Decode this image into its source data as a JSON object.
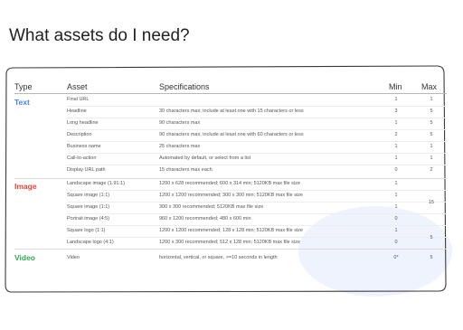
{
  "title": "What assets do I need?",
  "headers": {
    "type": "Type",
    "asset": "Asset",
    "specifications": "Specifications",
    "min": "Min",
    "max": "Max"
  },
  "types": {
    "text": "Text",
    "image": "Image",
    "video": "Video"
  },
  "colors": {
    "text": "#4285f4",
    "image": "#ea4335",
    "video": "#34a853"
  },
  "text_rows": [
    {
      "asset": "Final URL",
      "spec": "",
      "min": "1",
      "max": "1"
    },
    {
      "asset": "Headline",
      "spec": "30 characters max; include at least one with 15 characters or less",
      "min": "3",
      "max": "5"
    },
    {
      "asset": "Long headline",
      "spec": "90 characters max",
      "min": "1",
      "max": "5"
    },
    {
      "asset": "Description",
      "spec": "90 characters max; include at least one with 60 characters or less",
      "min": "2",
      "max": "5"
    },
    {
      "asset": "Business name",
      "spec": "25 characters max",
      "min": "1",
      "max": "1"
    },
    {
      "asset": "Call-to-action",
      "spec": "Automated by default, or select from a list",
      "min": "1",
      "max": "1"
    },
    {
      "asset": "Display URL path",
      "spec": "15 characters max each",
      "min": "0",
      "max": "2"
    }
  ],
  "image_rows": [
    {
      "asset": "Landscape image (1.91:1)",
      "spec": "1200 x 628 recommended; 600 x 314 min; 5120KB max file size",
      "min": "1"
    },
    {
      "asset": "Square image (1:1)",
      "spec": "1200 x 1200 recommended; 300 x 300 min; 5120KB max file size",
      "min": "1"
    },
    {
      "asset": "Square image (1:1)",
      "spec": "300 x 300 recommended; 5120KB max file size",
      "min": "1"
    },
    {
      "asset": "Portrait image (4:5)",
      "spec": "960 x 1200 recommended; 480 x 600 min",
      "min": "0"
    },
    {
      "asset": "Square logo (1:1)",
      "spec": "1200 x 1200 recommended; 128 x 128 min; 5120KB max file size",
      "min": "1"
    },
    {
      "asset": "Landscape logo (4:1)",
      "spec": "1200 x 300 recommended; 512 x 128 min; 5120KB max file size",
      "min": "0"
    }
  ],
  "image_max": {
    "images": "15",
    "logos": "5"
  },
  "video_rows": [
    {
      "asset": "Video",
      "spec": "horizontal, vertical, or square, >=10 seconds in length",
      "min": "0*",
      "max": "5"
    }
  ]
}
